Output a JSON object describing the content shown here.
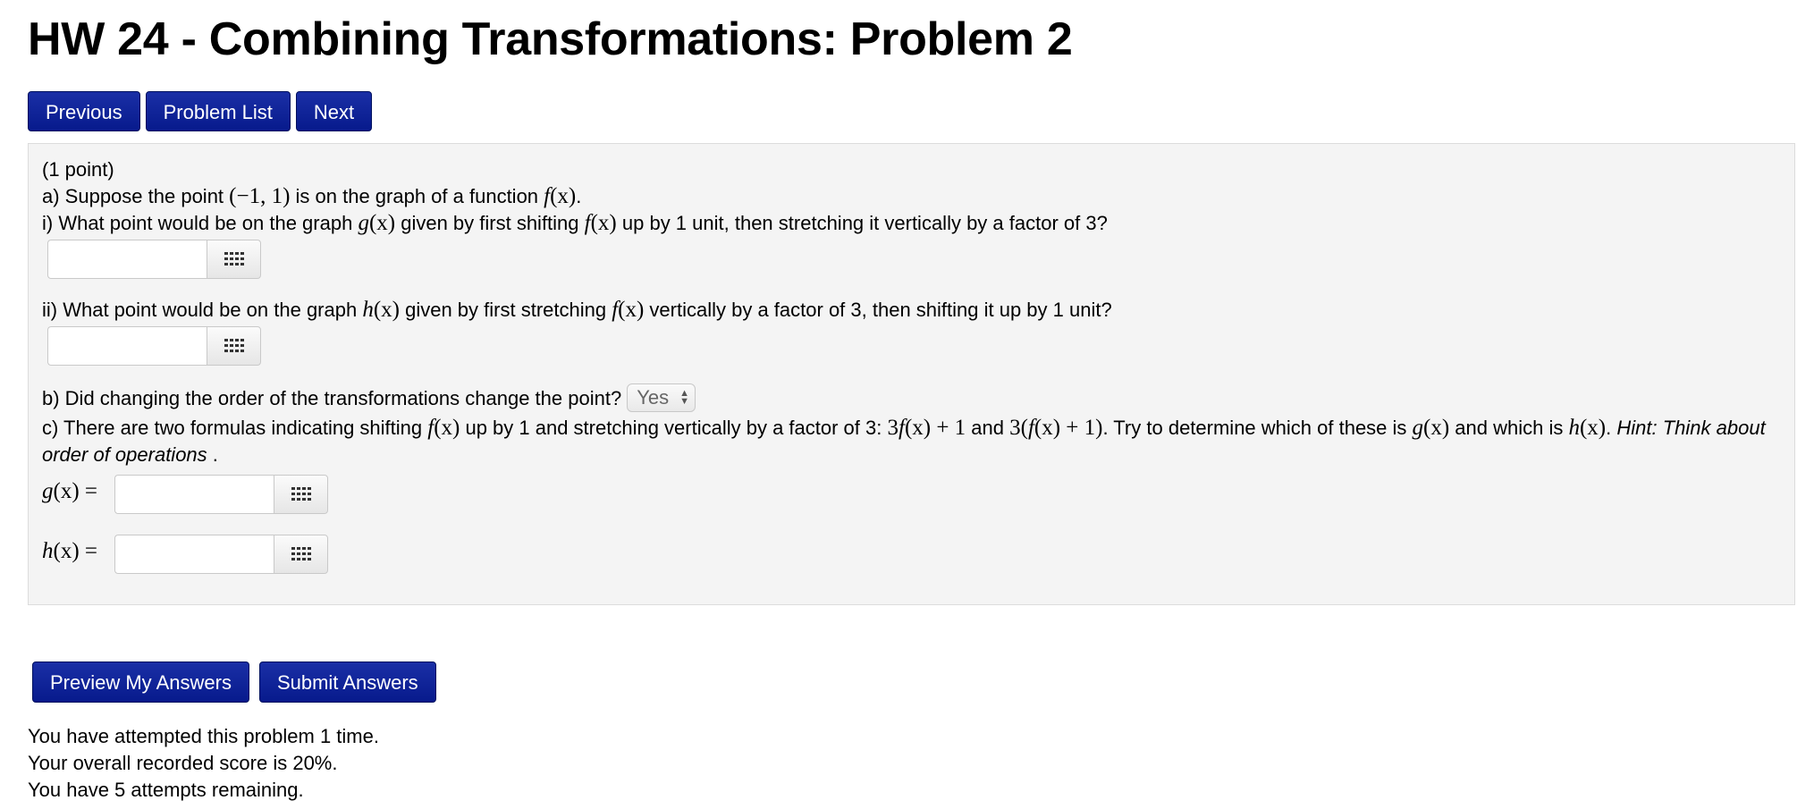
{
  "page_title": "HW 24 - Combining Transformations: Problem 2",
  "nav": {
    "previous_label": "Previous",
    "problem_list_label": "Problem List",
    "next_label": "Next"
  },
  "problem": {
    "points": "(1 point)",
    "part_a": {
      "pre": "a) Suppose the point ",
      "point": "(−1, 1)",
      "mid": " is on the graph of a function ",
      "func": "f",
      "func_arg": "(x)",
      "post": "."
    },
    "part_i": {
      "pre": "i) What point would be on the graph ",
      "g": "g",
      "g_arg": "(x)",
      "mid": " given by first shifting ",
      "f": "f",
      "f_arg": "(x)",
      "post": " up by 1 unit, then stretching it vertically by a factor of 3?",
      "answer_value": ""
    },
    "part_ii": {
      "pre": "ii) What point would be on the graph ",
      "h": "h",
      "h_arg": "(x)",
      "mid": " given by first stretching ",
      "f": "f",
      "f_arg": "(x)",
      "post": " vertically by a factor of 3, then shifting it up by 1 unit?",
      "answer_value": ""
    },
    "part_b": {
      "text": "b) Did changing the order of the transformations change the point?",
      "selected": "Yes"
    },
    "part_c": {
      "pre": "c) There are two formulas indicating shifting ",
      "f": "f",
      "f_arg": "(x)",
      "mid1": " up by 1 and stretching vertically by a factor of 3: ",
      "formula1_coef": "3",
      "formula1_f": "f",
      "formula1_rest": "(x) + 1",
      "and": " and ",
      "formula2_open": "3(",
      "formula2_f": "f",
      "formula2_rest": "(x) + 1)",
      "mid2": ". Try to determine which of these is ",
      "g": "g",
      "g_arg": "(x)",
      "mid3": " and which is ",
      "h": "h",
      "h_arg": "(x)",
      "mid4": ". ",
      "hint": "Hint: Think about order of operations",
      "end": " ."
    },
    "g_label": {
      "name": "g",
      "rest": "(x) ="
    },
    "h_label": {
      "name": "h",
      "rest": "(x) ="
    },
    "g_answer_value": "",
    "h_answer_value": ""
  },
  "actions": {
    "preview_label": "Preview My Answers",
    "submit_label": "Submit Answers"
  },
  "status": {
    "attempts": "You have attempted this problem 1 time.",
    "score": "Your overall recorded score is 20%.",
    "remaining": "You have 5 attempts remaining."
  },
  "colors": {
    "button_bg": "#0a1f96",
    "panel_bg": "#f4f4f4"
  }
}
